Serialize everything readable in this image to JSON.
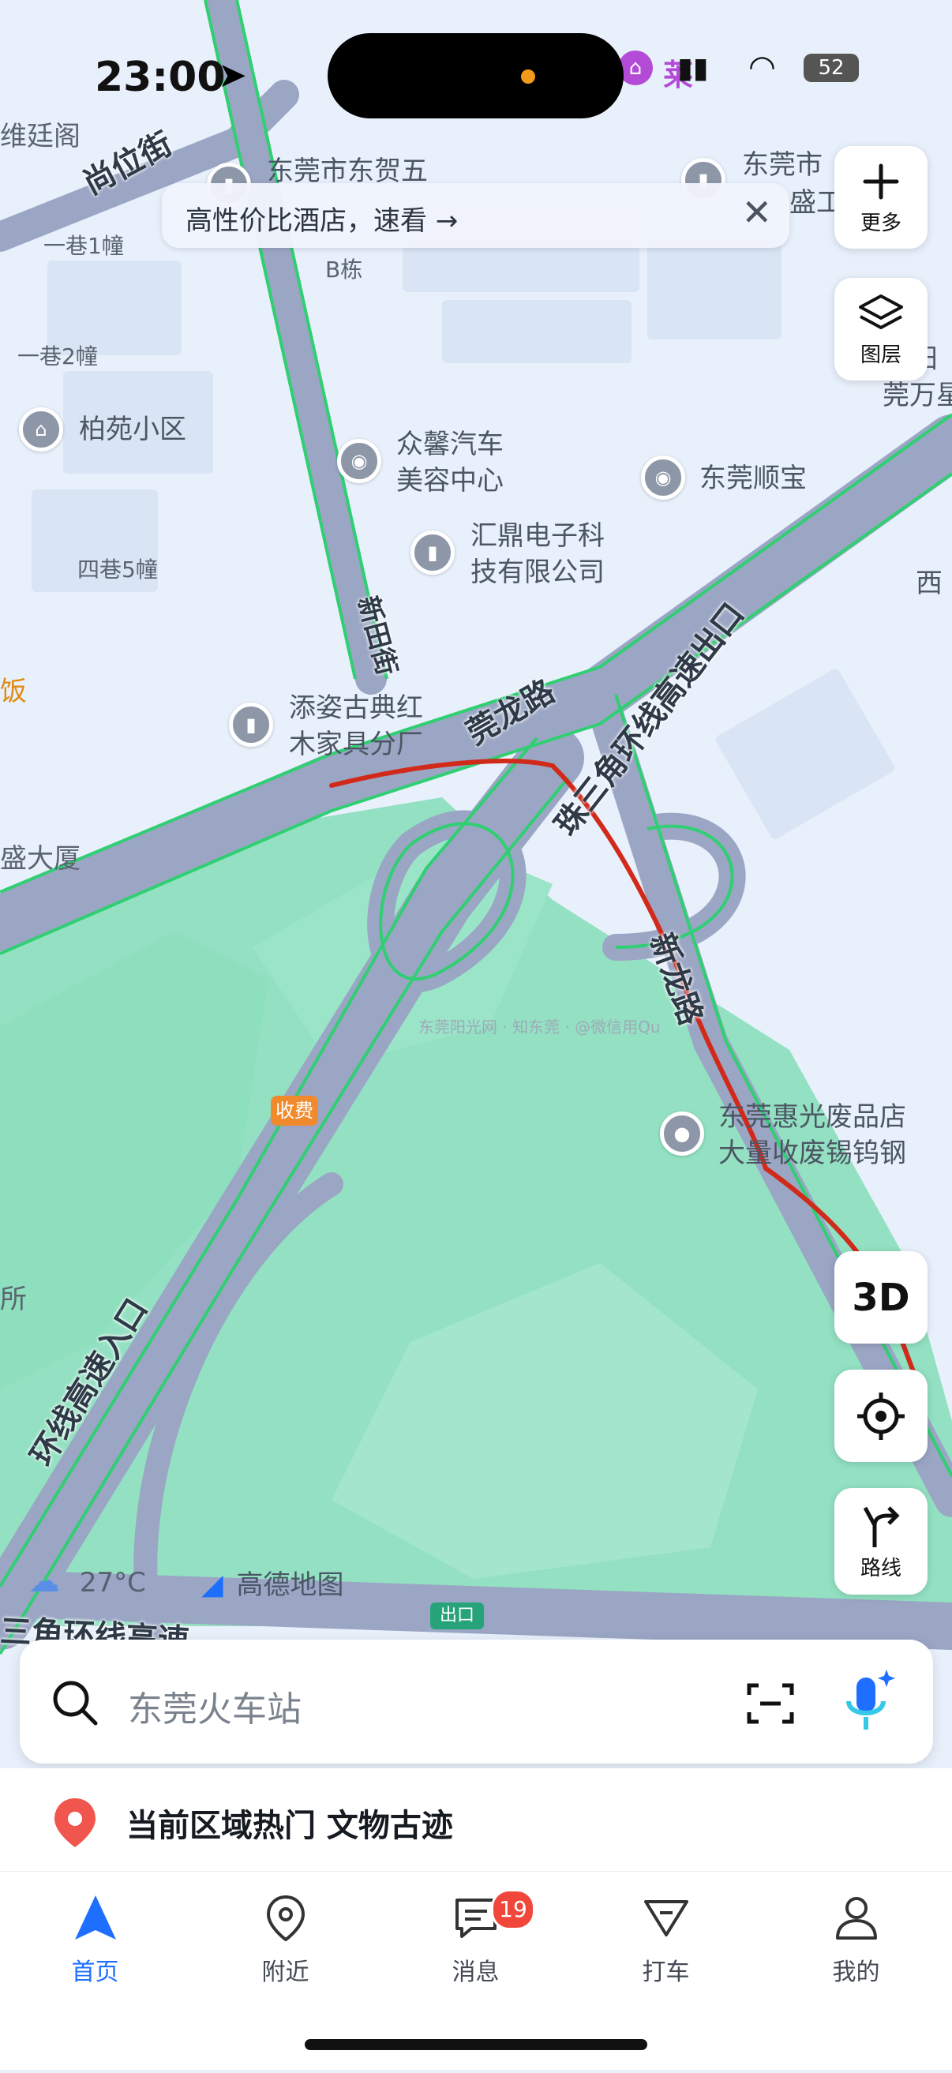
{
  "status_bar": {
    "time": "23:00",
    "notification_text": "莱",
    "battery_text": "52"
  },
  "banner": {
    "text": "高性价比酒店，速看 →"
  },
  "controls": {
    "more_label": "更多",
    "layers_label": "图层",
    "three_d_label": "3D",
    "route_label": "路线"
  },
  "map": {
    "area_labels": [
      "维廷阁",
      "一巷1幢",
      "一巷2幢",
      "四巷5幢",
      "B栋",
      "盛大厦",
      "所",
      "饭"
    ],
    "road_labels": {
      "shangwei_street": "尚位街",
      "xintian_street": "新田街",
      "guanlong_road": "莞龙路",
      "exit_road": "珠三角环线高速出口",
      "entrance_road": "环线高速入口",
      "xin_road": "新龙路",
      "bottom_road": "三角环线高速"
    },
    "pois": {
      "donghe": "东莞市东贺五",
      "dongwan_top": "东莞市",
      "baiyuan": "柏苑小区",
      "zhongxin_1": "众馨汽车",
      "zhongxin_2": "美容中心",
      "huiding_1": "汇鼎电子科",
      "huiding_2": "技有限公司",
      "shunbao": "东莞顺宝",
      "tianzi_1": "添姿古典红",
      "tianzi_2": "木家具分厂",
      "huiguang_1": "东莞惠光废品店",
      "huiguang_2": "大量收废锡钨钢",
      "right_1": "安阳",
      "right_2": "莞万星",
      "right_3": "西",
      "right_4": "盛工"
    },
    "toll_label": "收费",
    "exit_label": "出口",
    "watermark": "东莞阳光网 · 知东莞 · @微信用Qu"
  },
  "weather": {
    "temperature": "27°C"
  },
  "brand": {
    "name": "高德地图"
  },
  "search": {
    "placeholder": "东莞火车站"
  },
  "hot_topics": {
    "text": "当前区域热门 文物古迹"
  },
  "tabbar": {
    "tabs": [
      {
        "label": "首页",
        "icon": "navigation-arrow-icon",
        "active": true
      },
      {
        "label": "附近",
        "icon": "location-pin-icon"
      },
      {
        "label": "消息",
        "icon": "message-icon",
        "badge": "19"
      },
      {
        "label": "打车",
        "icon": "taxi-icon"
      },
      {
        "label": "我的",
        "icon": "profile-icon"
      }
    ]
  },
  "colors": {
    "accent": "#1e6fff",
    "route_line": "#d22a1a",
    "road": "#9aa6c4",
    "green": "#8fe0bf",
    "badge": "#f0473a"
  }
}
